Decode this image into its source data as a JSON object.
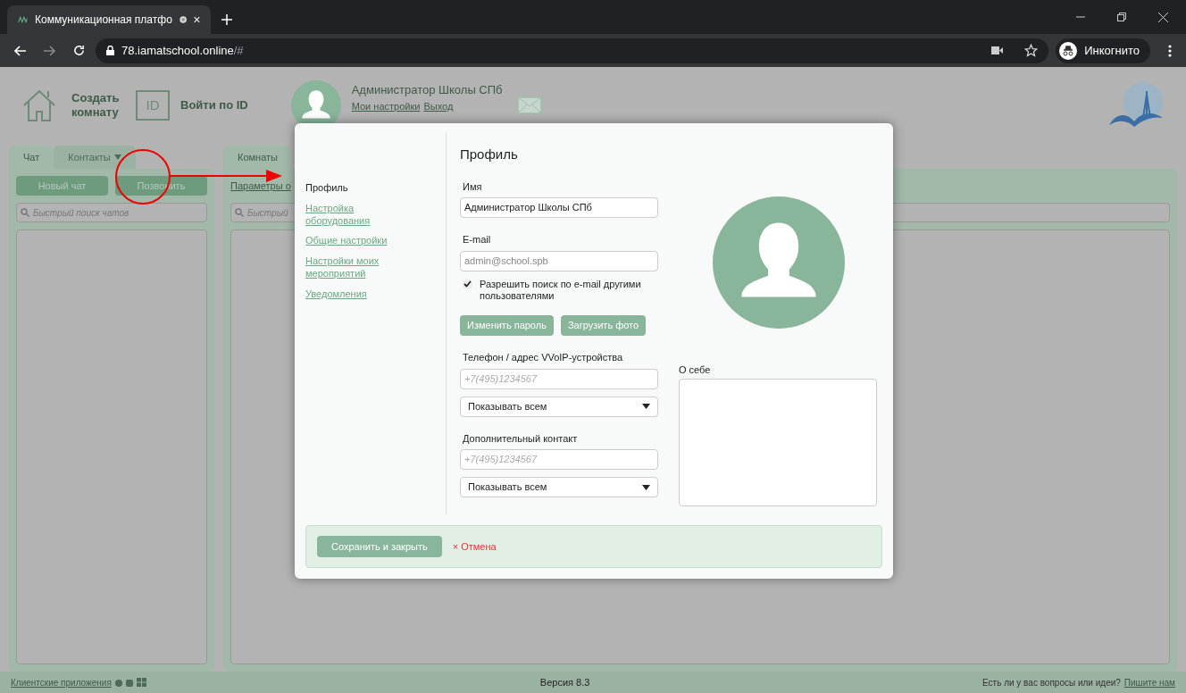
{
  "browser": {
    "tab_title": "Коммуникационная платфо",
    "url_host": "78.iamatschool.online",
    "url_path": "/#",
    "incognito": "Инкогнито"
  },
  "header": {
    "create_room": "Создать комнату",
    "id_badge": "ID",
    "login_by_id": "Войти по ID",
    "user_name": "Администратор Школы СПб",
    "links": [
      "Мои настройки",
      "Выход"
    ]
  },
  "left_panel": {
    "tabs": [
      {
        "label": "Чат",
        "selected": true
      },
      {
        "label": "Контакты",
        "selected": false
      }
    ],
    "buttons": [
      "Новый чат",
      "Позвонить"
    ],
    "search": {
      "placeholder": "Быстрый поиск чатов"
    }
  },
  "right_panel": {
    "tab": "Комнаты",
    "link": "Параметры о",
    "search": {
      "placeholder": "Быстрый"
    }
  },
  "dialog": {
    "nav": [
      {
        "label": "Профиль",
        "selected": true
      },
      {
        "label": "Настройка оборудования",
        "selected": false
      },
      {
        "label": "Общие настройки",
        "selected": false
      },
      {
        "label": "Настройки моих мероприятий",
        "selected": false
      },
      {
        "label": "Уведомления",
        "selected": false
      }
    ],
    "title": "Профиль",
    "name": {
      "label": "Имя",
      "value": "Администратор Школы СПб"
    },
    "email": {
      "label": "E-mail",
      "value": "admin@school.spb"
    },
    "email_search": {
      "label": "Разрешить поиск по e-mail другими пользователями",
      "checked": true
    },
    "buttons": [
      "Изменить пароль",
      "Загрузить фото"
    ],
    "phone": {
      "label": "Телефон / адрес VVoIP-устройства",
      "placeholder": "+7(495)1234567",
      "visibility": "Показывать всем"
    },
    "extra_contact": {
      "label": "Дополнительный контакт",
      "placeholder": "+7(495)1234567",
      "visibility": "Показывать всем"
    },
    "about": {
      "label": "О себе"
    },
    "save": "Сохранить и закрыть",
    "cancel_mark": "×",
    "cancel": "Отмена"
  },
  "footer": {
    "client_apps": "Клиентские приложения",
    "version": "Версия 8.3",
    "question": "Есть ли у вас вопросы или идеи?",
    "contact_link": "Пишите нам"
  }
}
